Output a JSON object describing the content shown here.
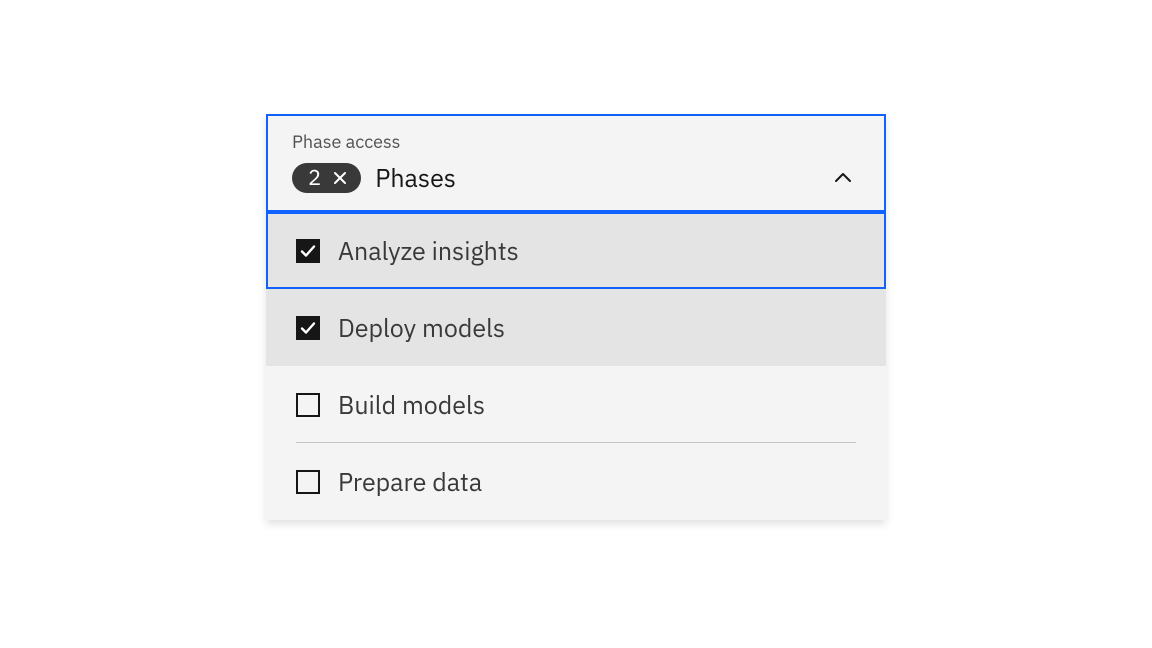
{
  "dropdown": {
    "label": "Phase access",
    "count": "2",
    "title": "Phases",
    "options": [
      {
        "label": "Analyze insights",
        "checked": true,
        "highlighted": true
      },
      {
        "label": "Deploy models",
        "checked": true,
        "highlighted": false
      },
      {
        "label": "Build models",
        "checked": false,
        "highlighted": false
      },
      {
        "label": "Prepare data",
        "checked": false,
        "highlighted": false
      }
    ]
  }
}
